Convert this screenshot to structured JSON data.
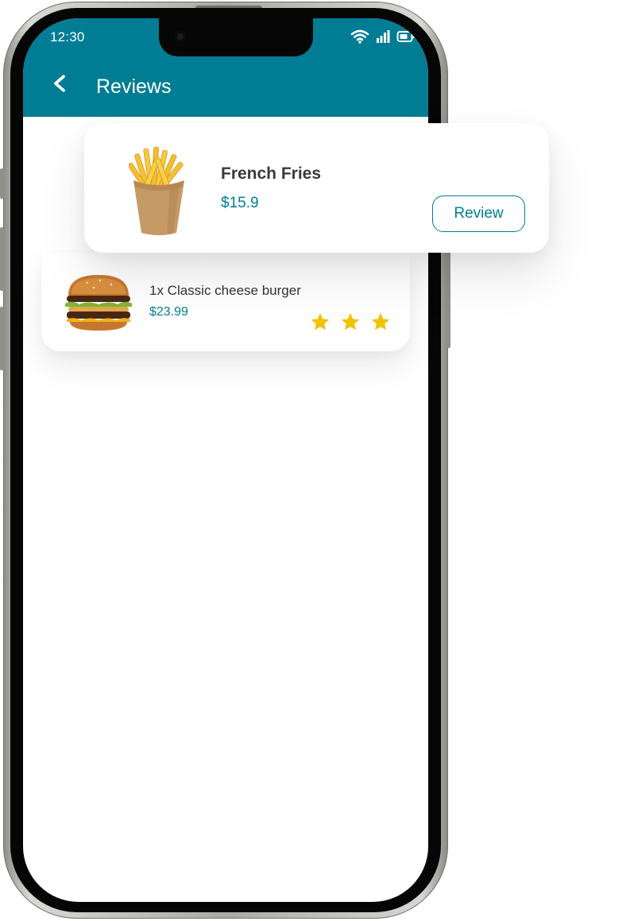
{
  "status_bar": {
    "time": "12:30"
  },
  "header": {
    "title": "Reviews"
  },
  "review_card": {
    "product_name": "French Fries",
    "price": "$15.9",
    "button_label": "Review"
  },
  "order_item": {
    "name": "1x Classic cheese burger",
    "price": "$23.99",
    "rating": 3
  },
  "colors": {
    "accent": "#007d94",
    "star": "#f2c200"
  }
}
